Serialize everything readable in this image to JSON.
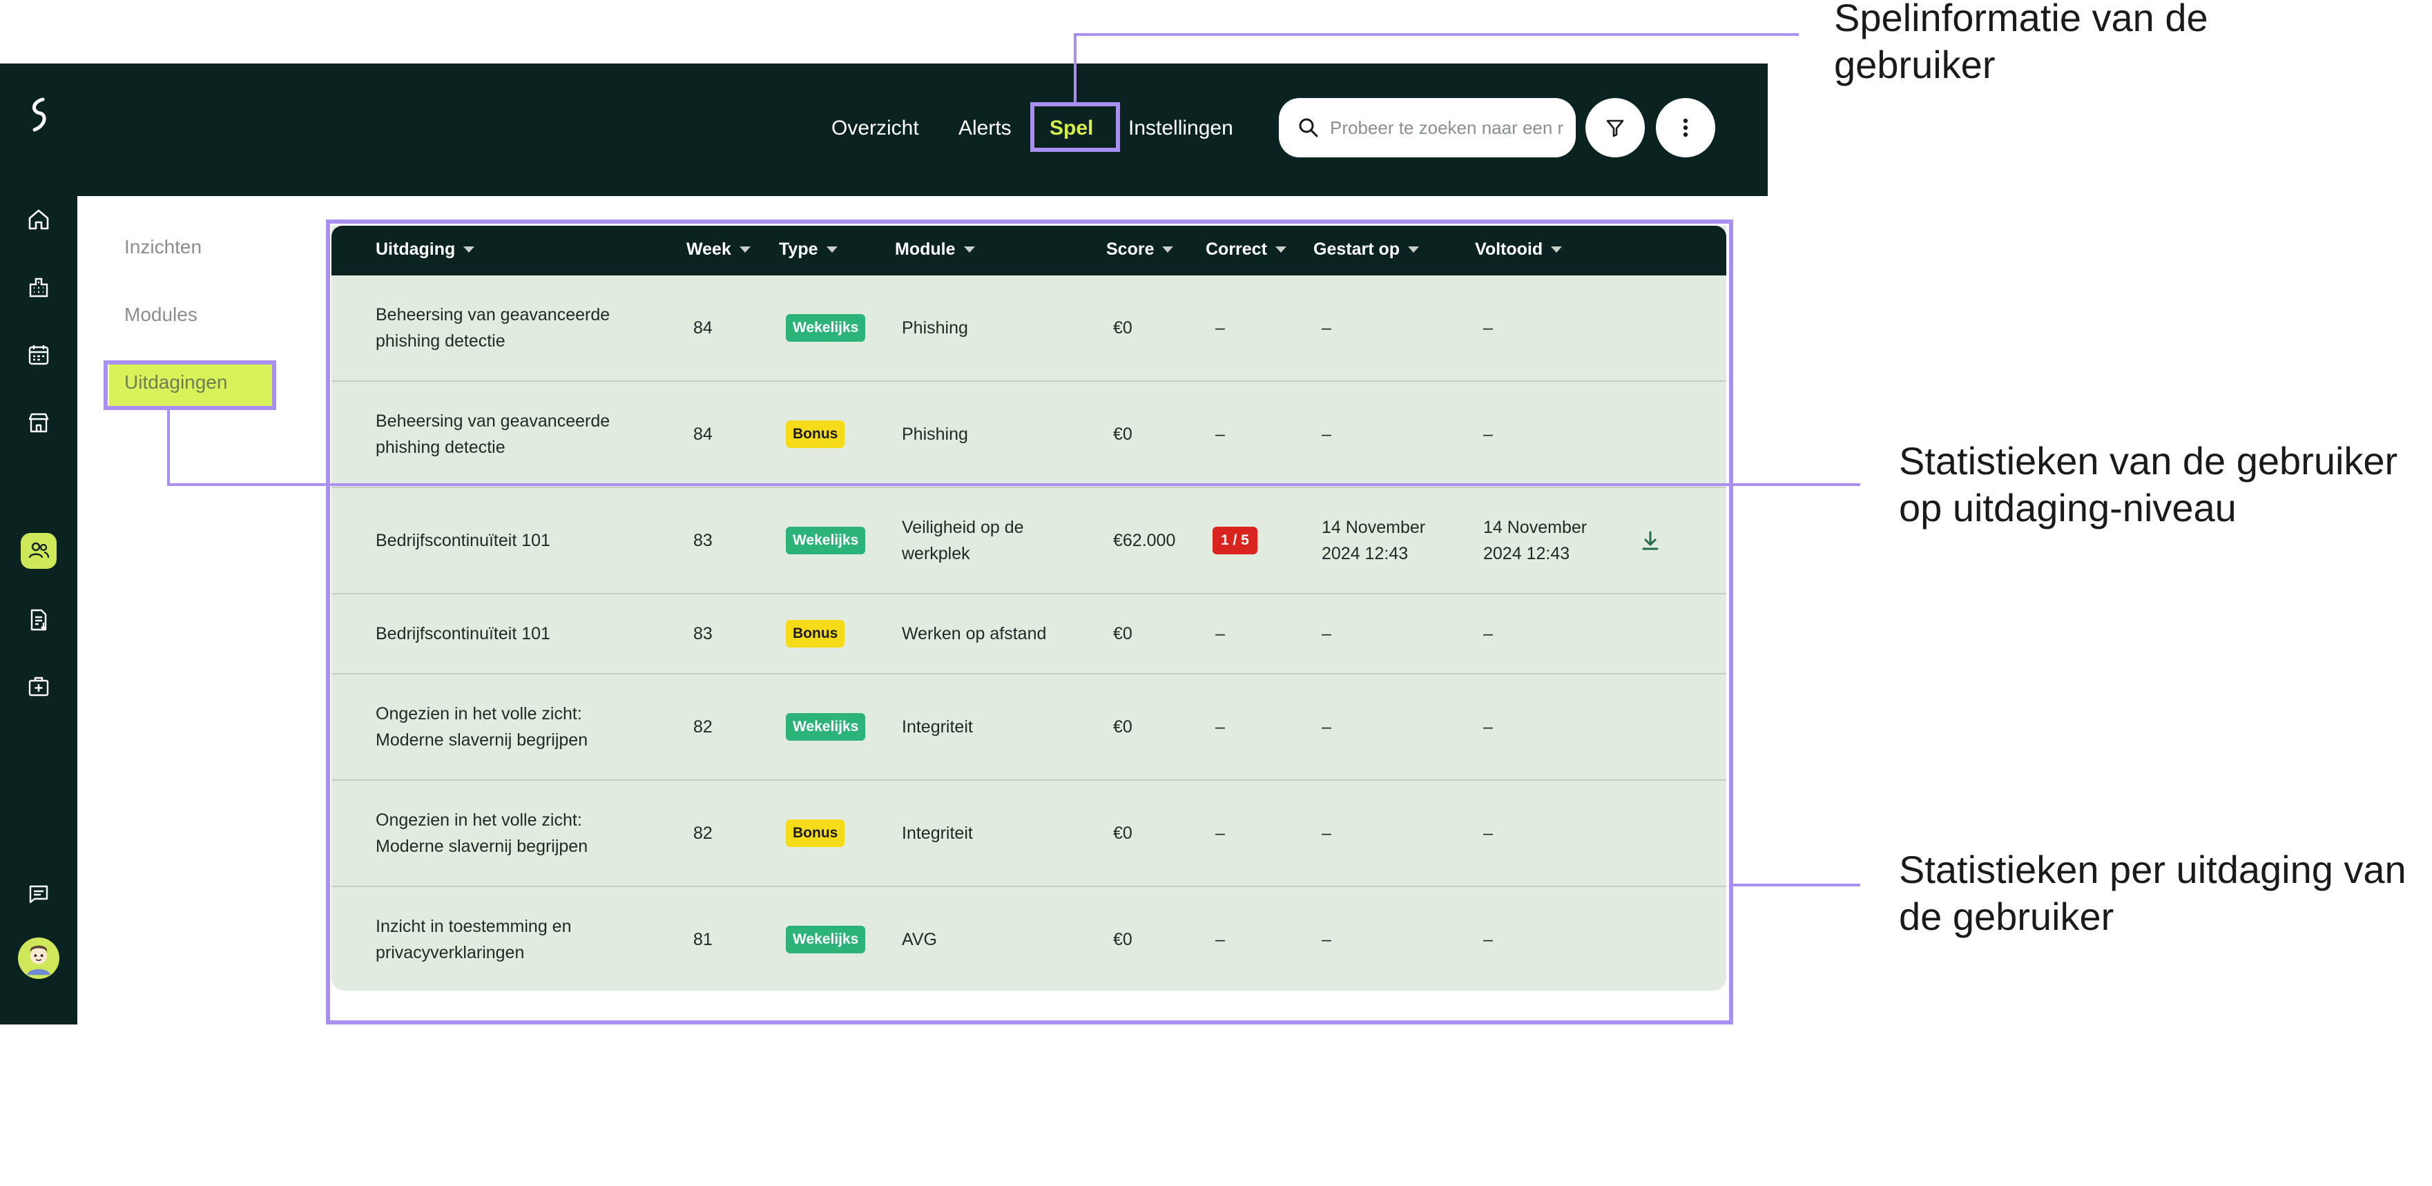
{
  "nav": {
    "tabs": [
      "Overzicht",
      "Alerts",
      "Spel",
      "Instellingen"
    ],
    "active_tab": "Spel"
  },
  "search": {
    "placeholder": "Probeer te zoeken naar een r"
  },
  "submenu": {
    "items": [
      "Inzichten",
      "Modules",
      "Uitdagingen"
    ],
    "active": "Uitdagingen"
  },
  "table": {
    "headers": [
      "Uitdaging",
      "Week",
      "Type",
      "Module",
      "Score",
      "Correct",
      "Gestart op",
      "Voltooid"
    ],
    "rows": [
      {
        "challenge_1": "Beheersing van geavanceerde",
        "challenge_2": "phishing detectie",
        "week": "84",
        "type": "Wekelijks",
        "module_1": "Phishing",
        "module_2": "",
        "score": "€0",
        "correct": "–",
        "started_1": "–",
        "started_2": "",
        "completed_1": "–",
        "completed_2": ""
      },
      {
        "challenge_1": "Beheersing van geavanceerde",
        "challenge_2": "phishing detectie",
        "week": "84",
        "type": "Bonus",
        "module_1": "Phishing",
        "module_2": "",
        "score": "€0",
        "correct": "–",
        "started_1": "–",
        "started_2": "",
        "completed_1": "–",
        "completed_2": ""
      },
      {
        "challenge_1": "Bedrijfscontinuïteit 101",
        "challenge_2": "",
        "week": "83",
        "type": "Wekelijks",
        "module_1": "Veiligheid op de",
        "module_2": "werkplek",
        "score": "€62.000",
        "correct": "1 / 5",
        "started_1": "14 November",
        "started_2": "2024 12:43",
        "completed_1": "14 November",
        "completed_2": "2024 12:43"
      },
      {
        "challenge_1": "Bedrijfscontinuïteit 101",
        "challenge_2": "",
        "week": "83",
        "type": "Bonus",
        "module_1": "Werken op afstand",
        "module_2": "",
        "score": "€0",
        "correct": "–",
        "started_1": "–",
        "started_2": "",
        "completed_1": "–",
        "completed_2": ""
      },
      {
        "challenge_1": "Ongezien in het volle zicht:",
        "challenge_2": "Moderne slavernij begrijpen",
        "week": "82",
        "type": "Wekelijks",
        "module_1": "Integriteit",
        "module_2": "",
        "score": "€0",
        "correct": "–",
        "started_1": "–",
        "started_2": "",
        "completed_1": "–",
        "completed_2": ""
      },
      {
        "challenge_1": "Ongezien in het volle zicht:",
        "challenge_2": "Moderne slavernij begrijpen",
        "week": "82",
        "type": "Bonus",
        "module_1": "Integriteit",
        "module_2": "",
        "score": "€0",
        "correct": "–",
        "started_1": "–",
        "started_2": "",
        "completed_1": "–",
        "completed_2": ""
      },
      {
        "challenge_1": "Inzicht in toestemming en",
        "challenge_2": "privacyverklaringen",
        "week": "81",
        "type": "Wekelijks",
        "module_1": "AVG",
        "module_2": "",
        "score": "€0",
        "correct": "–",
        "started_1": "–",
        "started_2": "",
        "completed_1": "–",
        "completed_2": ""
      }
    ]
  },
  "annotations": {
    "game_info": [
      "Spelinformatie van de",
      "gebruiker"
    ],
    "challenge_level": [
      "Statistieken van de gebruiker",
      "op uitdaging-niveau"
    ],
    "per_challenge": [
      "Statistieken per uitdaging van",
      "de gebruiker"
    ]
  },
  "colors": {
    "dark": "#0b2320",
    "accent": "#d7ef4f",
    "weekly_badge": "#2bb37a",
    "bonus_badge": "#f6db1b",
    "correct_badge": "#d8231f",
    "annotation": "#a98ff0",
    "table_bg": "#e2ebe0"
  },
  "icons": {
    "sidebar": [
      "home-icon",
      "building-icon",
      "calendar-icon",
      "store-icon",
      "users-icon",
      "report-icon",
      "medical-icon",
      "chat-icon"
    ],
    "download": "download-icon"
  }
}
